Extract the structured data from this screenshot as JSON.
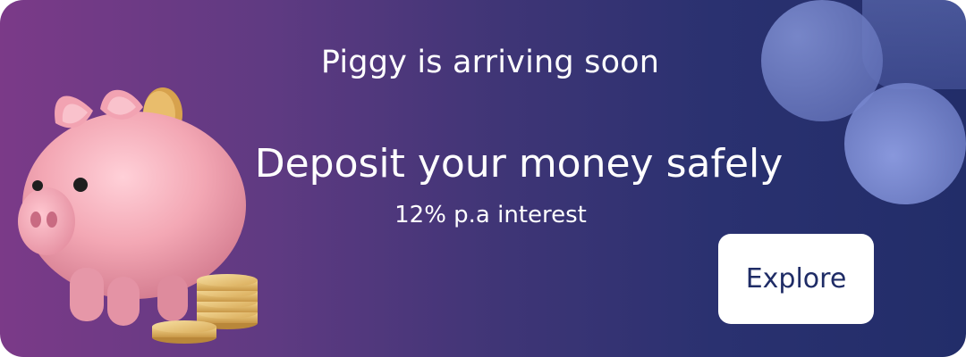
{
  "banner": {
    "title": "Piggy is arriving soon",
    "headline": "Deposit your money safely",
    "subline": "12% p.a interest",
    "cta_label": "Explore"
  },
  "colors": {
    "gradient_start": "#7b3a88",
    "gradient_end": "#222d69",
    "button_text": "#1f2c66",
    "piggy_pink": "#f4a9b6",
    "coin_gold": "#e9c173"
  },
  "icons": {
    "illustration": "piggy-bank-with-coins"
  }
}
